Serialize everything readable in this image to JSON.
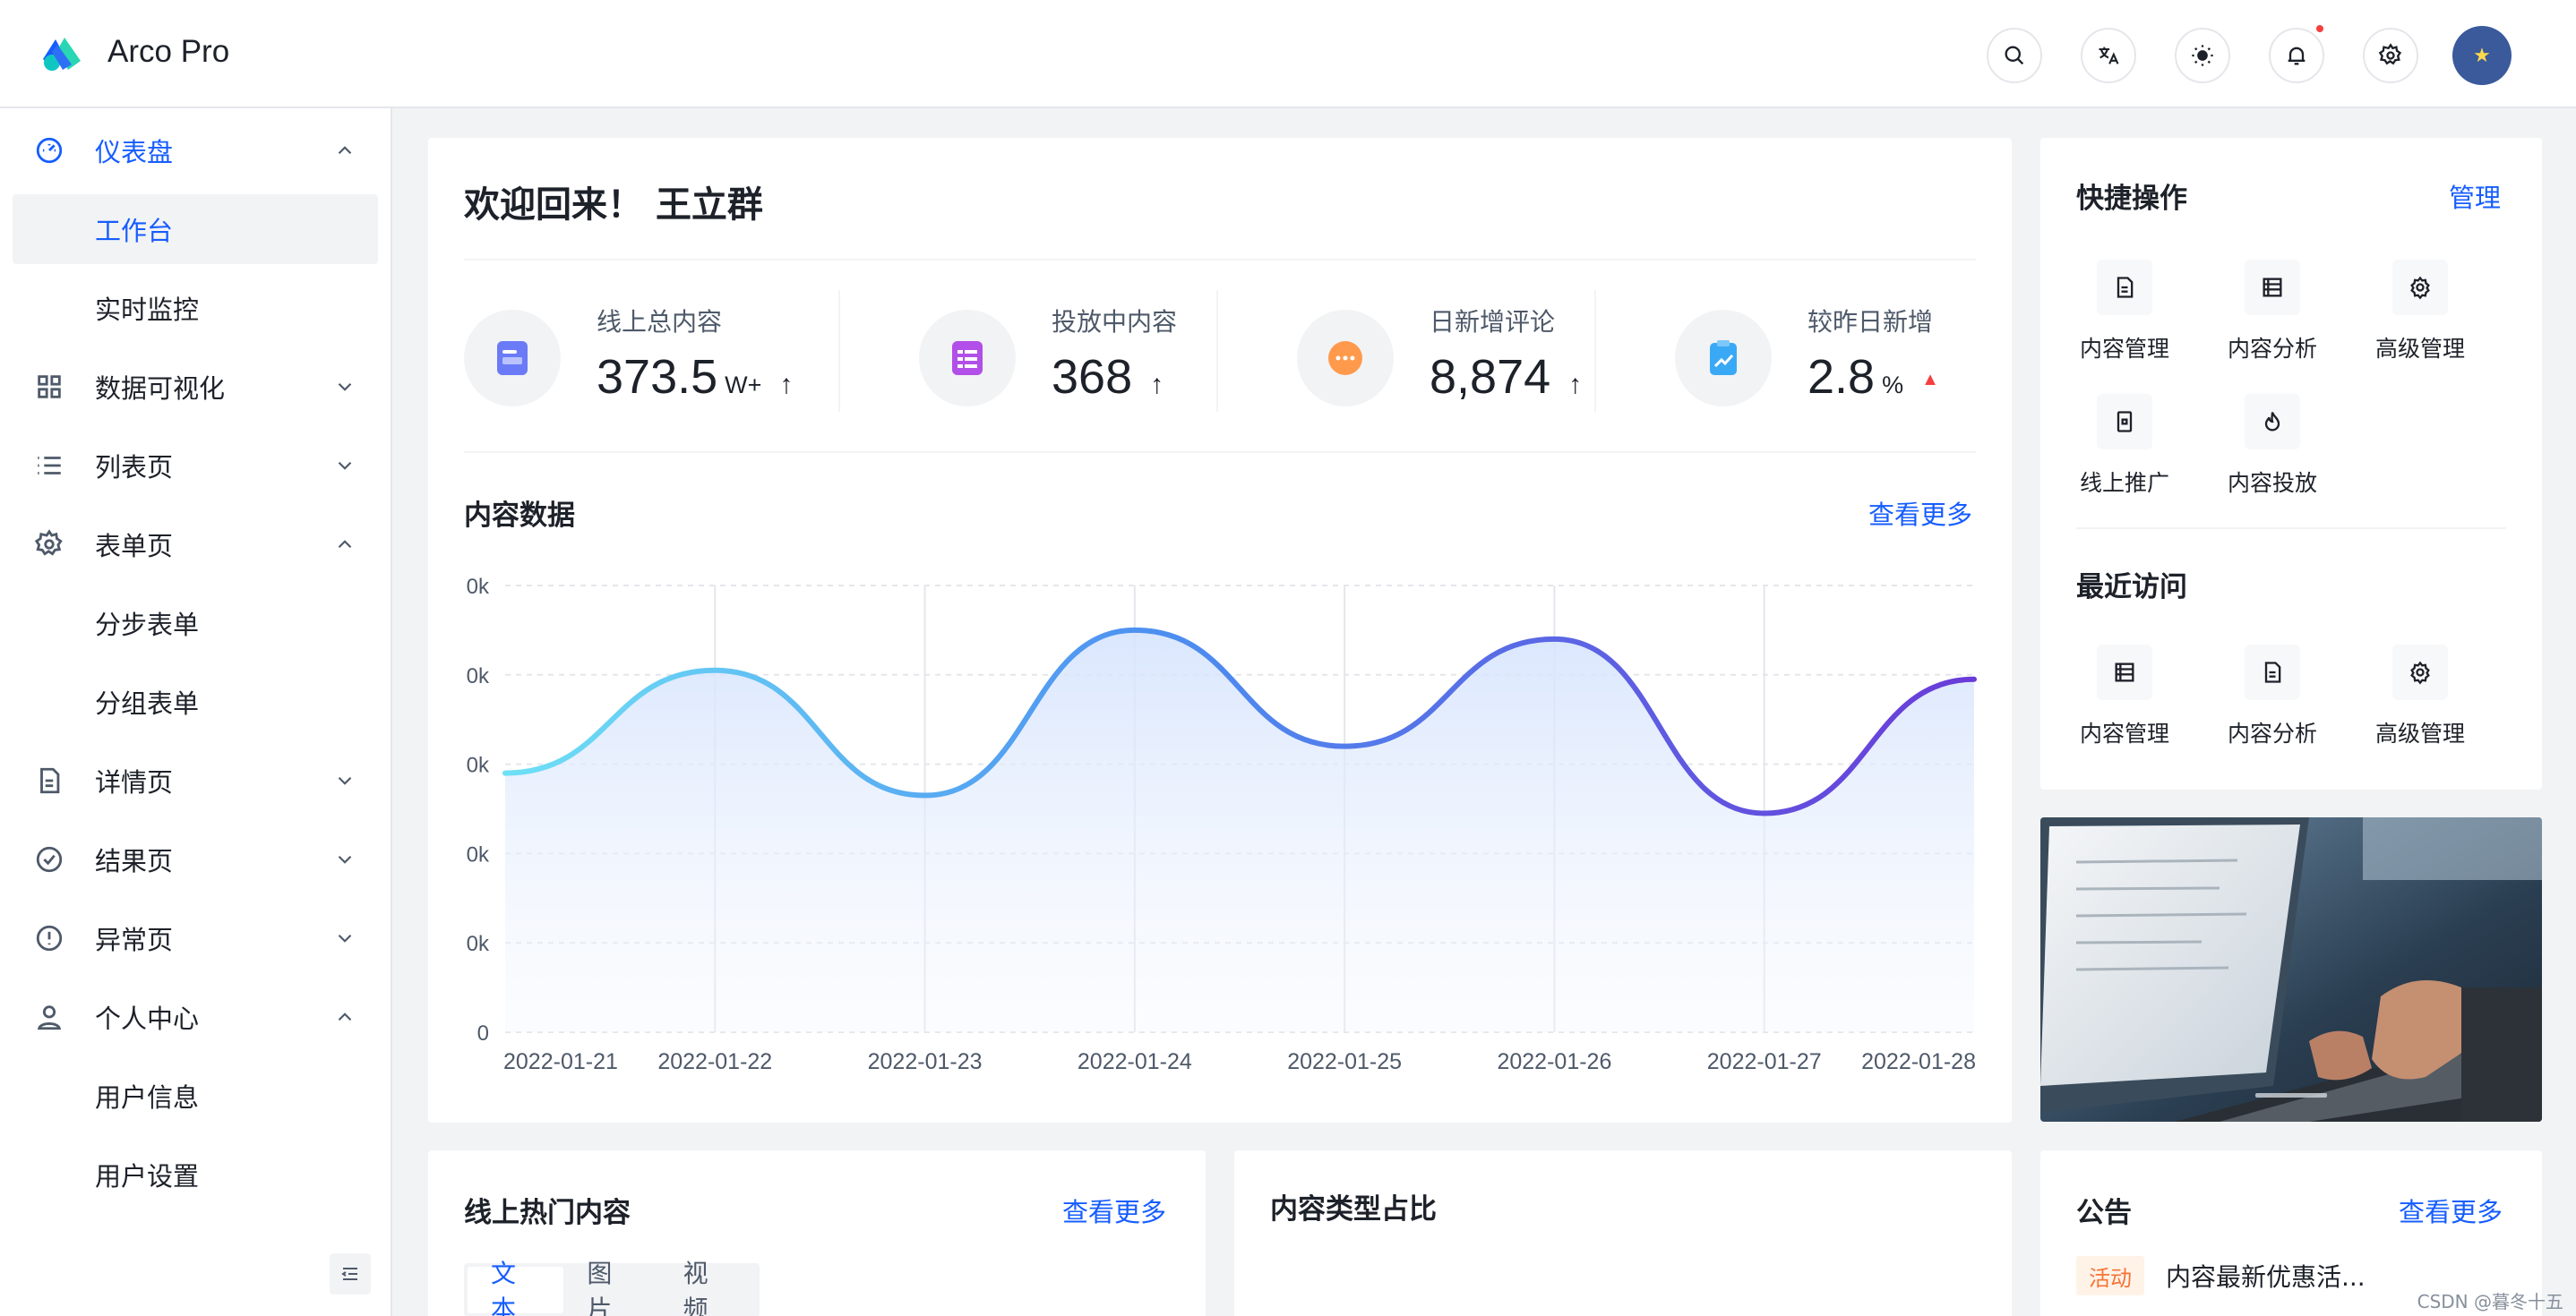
{
  "app": {
    "title": "Arco Pro"
  },
  "user": {
    "name": "王立群"
  },
  "sidebar": {
    "items": [
      {
        "label": "仪表盘",
        "icon": "dashboard-icon",
        "expanded": true
      },
      {
        "label": "工作台"
      },
      {
        "label": "实时监控"
      },
      {
        "label": "数据可视化",
        "icon": "grid-icon",
        "expanded": false
      },
      {
        "label": "列表页",
        "icon": "list-icon",
        "expanded": false
      },
      {
        "label": "表单页",
        "icon": "gear-icon",
        "expanded": true
      },
      {
        "label": "分步表单"
      },
      {
        "label": "分组表单"
      },
      {
        "label": "详情页",
        "icon": "file-icon",
        "expanded": false
      },
      {
        "label": "结果页",
        "icon": "check-circle-icon",
        "expanded": false
      },
      {
        "label": "异常页",
        "icon": "exclamation-icon",
        "expanded": false
      },
      {
        "label": "个人中心",
        "icon": "user-icon",
        "expanded": true
      },
      {
        "label": "用户信息"
      },
      {
        "label": "用户设置"
      }
    ]
  },
  "welcome": {
    "greeting": "欢迎回来！",
    "name": "王立群"
  },
  "stats": [
    {
      "label": "线上总内容",
      "value": "373.5",
      "unit": "W+",
      "trend": "↑",
      "icon_color": "#6b7bf7"
    },
    {
      "label": "投放中内容",
      "value": "368",
      "unit": "",
      "trend": "↑",
      "icon_color": "#b14fe8"
    },
    {
      "label": "日新增评论",
      "value": "8,874",
      "unit": "",
      "trend": "↑",
      "icon_color": "#ff9a4d"
    },
    {
      "label": "较昨日新增",
      "value": "2.8",
      "unit": "%",
      "trend": "▲",
      "icon_color": "#3aa9f5"
    }
  ],
  "content_data": {
    "title": "内容数据",
    "more": "查看更多"
  },
  "chart_data": {
    "type": "area",
    "categories": [
      "2022-01-21",
      "2022-01-22",
      "2022-01-23",
      "2022-01-24",
      "2022-01-25",
      "2022-01-26",
      "2022-01-27",
      "2022-01-28"
    ],
    "y_tick_labels": [
      "0k",
      "0k",
      "0k",
      "0k",
      "0k",
      "0"
    ],
    "values_fraction": [
      0.58,
      0.81,
      0.53,
      0.9,
      0.64,
      0.88,
      0.49,
      0.79
    ],
    "colors": [
      "#6ee0f5",
      "#4c7ef0",
      "#6a3bd8"
    ],
    "grid": true
  },
  "quick_ops": {
    "title": "快捷操作",
    "manage": "管理",
    "items": [
      {
        "label": "内容管理",
        "icon": "file-icon"
      },
      {
        "label": "内容分析",
        "icon": "table-icon"
      },
      {
        "label": "高级管理",
        "icon": "gear-icon"
      },
      {
        "label": "线上推广",
        "icon": "mobile-icon"
      },
      {
        "label": "内容投放",
        "icon": "fire-icon"
      }
    ]
  },
  "recent": {
    "title": "最近访问",
    "items": [
      {
        "label": "内容管理",
        "icon": "table-icon"
      },
      {
        "label": "内容分析",
        "icon": "file-icon"
      },
      {
        "label": "高级管理",
        "icon": "gear-icon"
      }
    ]
  },
  "hot": {
    "title": "线上热门内容",
    "more": "查看更多",
    "tabs": [
      "文本",
      "图片",
      "视频"
    ]
  },
  "pie": {
    "title": "内容类型占比"
  },
  "notice": {
    "title": "公告",
    "more": "查看更多",
    "tag": "活动",
    "text": "内容最新优惠活..."
  },
  "watermark": "CSDN @暮冬十五"
}
